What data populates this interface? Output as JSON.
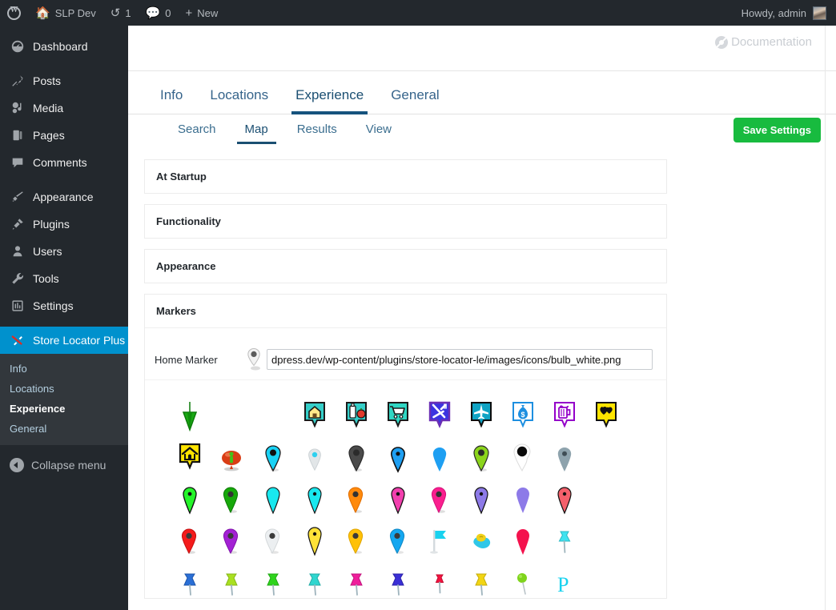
{
  "adminbar": {
    "logo_icon": "wordpress-icon",
    "site_icon": "home-icon",
    "site_name": "SLP Dev",
    "updates_icon": "updates-icon",
    "updates_count": "1",
    "comments_icon": "comment-icon",
    "comments_count": "0",
    "new_icon": "plus-icon",
    "new_label": "New",
    "howdy": "Howdy, admin",
    "avatar_name": "user-avatar"
  },
  "sidebar": {
    "items": [
      {
        "label": "Dashboard",
        "icon": "dashboard-icon",
        "name": "dashboard"
      },
      {
        "label": "Posts",
        "icon": "pin-icon",
        "name": "posts"
      },
      {
        "label": "Media",
        "icon": "media-icon",
        "name": "media"
      },
      {
        "label": "Pages",
        "icon": "page-icon",
        "name": "pages"
      },
      {
        "label": "Comments",
        "icon": "comment-icon",
        "name": "comments"
      },
      {
        "label": "Appearance",
        "icon": "brush-icon",
        "name": "appearance"
      },
      {
        "label": "Plugins",
        "icon": "plug-icon",
        "name": "plugins"
      },
      {
        "label": "Users",
        "icon": "user-icon",
        "name": "users"
      },
      {
        "label": "Tools",
        "icon": "wrench-icon",
        "name": "tools"
      },
      {
        "label": "Settings",
        "icon": "settings-icon",
        "name": "settings"
      },
      {
        "label": "Store Locator Plus",
        "icon": "store-locator-icon",
        "name": "store-locator-plus",
        "current": true
      }
    ],
    "submenu": [
      {
        "label": "Info",
        "current": false
      },
      {
        "label": "Locations",
        "current": false
      },
      {
        "label": "Experience",
        "current": true
      },
      {
        "label": "General",
        "current": false
      }
    ],
    "collapse_label": "Collapse menu",
    "collapse_icon": "collapse-arrow-icon",
    "accent_color": "#0091cd",
    "bg_color": "#23282d",
    "submenu_bg": "#32373c"
  },
  "content": {
    "documentation": {
      "label": "Documentation",
      "icon": "documentation-icon"
    },
    "top_tabs": [
      {
        "label": "Info",
        "active": false
      },
      {
        "label": "Locations",
        "active": false
      },
      {
        "label": "Experience",
        "active": true
      },
      {
        "label": "General",
        "active": false
      }
    ],
    "sub_tabs": [
      {
        "label": "Search",
        "active": false
      },
      {
        "label": "Map",
        "active": true
      },
      {
        "label": "Results",
        "active": false
      },
      {
        "label": "View",
        "active": false
      }
    ],
    "save_button": "Save Settings",
    "save_button_color": "#18bb3f",
    "panels": [
      {
        "title": "At Startup",
        "expanded": false
      },
      {
        "title": "Functionality",
        "expanded": false
      },
      {
        "title": "Appearance",
        "expanded": false
      },
      {
        "title": "Markers",
        "expanded": true
      }
    ],
    "markers_panel": {
      "home_marker_label": "Home Marker",
      "home_marker_value": "dpress.dev/wp-content/plugins/store-locator-le/images/icons/bulb_white.png",
      "home_marker_preview_icon": "grey-pin-icon"
    },
    "marker_grid": {
      "rows": [
        [
          {
            "name": "green-down-arrow-marker",
            "style": "arrow",
            "c1": "#1aa814",
            "c2": "#0c7a0a"
          },
          {
            "name": "empty-slot",
            "style": "empty"
          },
          {
            "name": "empty-slot",
            "style": "empty"
          },
          {
            "name": "house-tag-marker",
            "style": "tag",
            "c1": "#35cfc9",
            "c2": "#222222",
            "sym": "house"
          },
          {
            "name": "groceries-tag-marker",
            "style": "tag",
            "c1": "#35cfc9",
            "c2": "#222222",
            "sym": "bottle"
          },
          {
            "name": "shopping-cart-tag-marker",
            "style": "tag",
            "c1": "#2fd6c3",
            "c2": "#222222",
            "sym": "cart"
          },
          {
            "name": "restaurant-tag-marker",
            "style": "tag",
            "c1": "#3b34e0",
            "c2": "#6b2fb5",
            "sym": "cutlery"
          },
          {
            "name": "airport-tag-marker",
            "style": "tag",
            "c1": "#0fa3c4",
            "c2": "#111111",
            "sym": "plane"
          },
          {
            "name": "bank-tag-marker",
            "style": "tag",
            "c1": "#ffffff",
            "c2": "#1d8fe0",
            "sym": "money"
          },
          {
            "name": "bar-tag-marker",
            "style": "tag",
            "c1": "#ffffff",
            "c2": "#9400c9",
            "sym": "beer"
          },
          {
            "name": "favorites-tag-marker",
            "style": "tag",
            "c1": "#ffe500",
            "c2": "#111111",
            "sym": "hearts"
          }
        ],
        [
          {
            "name": "yellow-home-marker",
            "style": "tag",
            "c1": "#ffe400",
            "c2": "#111111",
            "sym": "house2"
          },
          {
            "name": "red-person-balloon-marker",
            "style": "balloon",
            "c1": "#d93d15",
            "c2": "#43c11a"
          },
          {
            "name": "cyan-teardrop-marker",
            "style": "teardrop",
            "c1": "#19d2f5",
            "c2": "#1b1b1b"
          },
          {
            "name": "light-grey-teardrop-marker",
            "style": "teardrop",
            "c1": "#e2e6e8",
            "c2": "#2fd0ef"
          },
          {
            "name": "dark-grey-teardrop-marker",
            "style": "teardrop",
            "c1": "#4a4a4a",
            "c2": "#2b2b2b"
          },
          {
            "name": "blue-teardrop-marker",
            "style": "teardrop",
            "c1": "#1e9ff2",
            "c2": "#111111"
          },
          {
            "name": "blue-plain-teardrop-marker",
            "style": "teardrop",
            "c1": "#1e9ff2",
            "c2": "#1e9ff2"
          },
          {
            "name": "green-teardrop-marker",
            "style": "teardrop",
            "c1": "#8bd41b",
            "c2": "#2a2a2a"
          },
          {
            "name": "black-outline-teardrop-marker",
            "style": "teardrop",
            "c1": "#ffffff",
            "c2": "#0a0a0a"
          },
          {
            "name": "slate-teardrop-marker",
            "style": "teardrop",
            "c1": "#8ea3ad",
            "c2": "#3f4d55"
          }
        ],
        [
          {
            "name": "bright-green-pin-marker",
            "style": "pin",
            "c1": "#25f52a",
            "c2": "#111111"
          },
          {
            "name": "dark-green-pin-marker",
            "style": "pin",
            "c1": "#17a80a",
            "c2": "#333333"
          },
          {
            "name": "cyan-pin-marker",
            "style": "pin",
            "c1": "#18e8ef",
            "c2": "#18e8ef"
          },
          {
            "name": "cyan-dot-pin-marker",
            "style": "pin",
            "c1": "#18e8ef",
            "c2": "#111111"
          },
          {
            "name": "orange-pin-marker",
            "style": "pin",
            "c1": "#ff8a0c",
            "c2": "#333333"
          },
          {
            "name": "magenta-pin-marker",
            "style": "pin",
            "c1": "#f23fae",
            "c2": "#111111"
          },
          {
            "name": "pink-pin-marker",
            "style": "pin",
            "c1": "#fa1f8e",
            "c2": "#333333"
          },
          {
            "name": "violet-pin-marker",
            "style": "pin",
            "c1": "#8d7ae8",
            "c2": "#111111"
          },
          {
            "name": "purple-plain-pin-marker",
            "style": "pin",
            "c1": "#8d7ae8",
            "c2": "#8d7ae8"
          },
          {
            "name": "salmon-pin-marker",
            "style": "pin",
            "c1": "#f4606b",
            "c2": "#111111"
          }
        ],
        [
          {
            "name": "red-pin-marker",
            "style": "pin",
            "c1": "#f41b1b",
            "c2": "#3a3a3a"
          },
          {
            "name": "purple-pin-marker",
            "style": "pin",
            "c1": "#a321d4",
            "c2": "#3a3a3a"
          },
          {
            "name": "white-pin-marker",
            "style": "pin",
            "c1": "#eceff1",
            "c2": "#3a3a3a"
          },
          {
            "name": "yellow-dot-pin-marker",
            "style": "pin",
            "c1": "#ffe338",
            "c2": "#111111"
          },
          {
            "name": "gold-pin-marker",
            "style": "pin",
            "c1": "#ffc107",
            "c2": "#3a3a3a"
          },
          {
            "name": "azure-pin-marker",
            "style": "pin",
            "c1": "#14a7f0",
            "c2": "#3a3a3a"
          },
          {
            "name": "cyan-flag-marker",
            "style": "flag",
            "c1": "#18d2ef",
            "c2": "#b0b8bd"
          },
          {
            "name": "yellow-blue-blob-marker",
            "style": "blob",
            "c1": "#f0d11a",
            "c2": "#2fc7e8"
          },
          {
            "name": "crimson-teardrop-marker",
            "style": "teardrop",
            "c1": "#f4124d",
            "c2": "#f4124d"
          },
          {
            "name": "cyan-pushpin-marker",
            "style": "pushpin",
            "c1": "#3fe3f0",
            "c2": "#9fb4bd"
          }
        ],
        [
          {
            "name": "blue-pushpin-marker",
            "style": "pushpin",
            "c1": "#2a6fd6",
            "c2": "#9fb4bd"
          },
          {
            "name": "lime-pushpin-marker",
            "style": "pushpin",
            "c1": "#a9e020",
            "c2": "#9fb4bd"
          },
          {
            "name": "green-pushpin-marker",
            "style": "pushpin",
            "c1": "#2ed41c",
            "c2": "#9fb4bd"
          },
          {
            "name": "teal-pushpin-marker",
            "style": "pushpin",
            "c1": "#2fd6cf",
            "c2": "#9fb4bd"
          },
          {
            "name": "magenta-pushpin-marker",
            "style": "pushpin",
            "c1": "#ef1e9b",
            "c2": "#9fb4bd"
          },
          {
            "name": "indigo-pushpin-marker",
            "style": "pushpin",
            "c1": "#3a2fd6",
            "c2": "#9fb4bd"
          },
          {
            "name": "red-small-pushpin-marker",
            "style": "pushpin-sm",
            "c1": "#f4123f",
            "c2": "#9fb4bd"
          },
          {
            "name": "yellow-pushpin-marker",
            "style": "pushpin",
            "c1": "#f2d513",
            "c2": "#9fb4bd"
          },
          {
            "name": "green-ball-pin-marker",
            "style": "ballpin",
            "c1": "#7fd41c",
            "c2": "#b9c3c8"
          },
          {
            "name": "parking-marker",
            "style": "letter",
            "c1": "#18d2ef",
            "sym": "P"
          }
        ]
      ]
    }
  }
}
